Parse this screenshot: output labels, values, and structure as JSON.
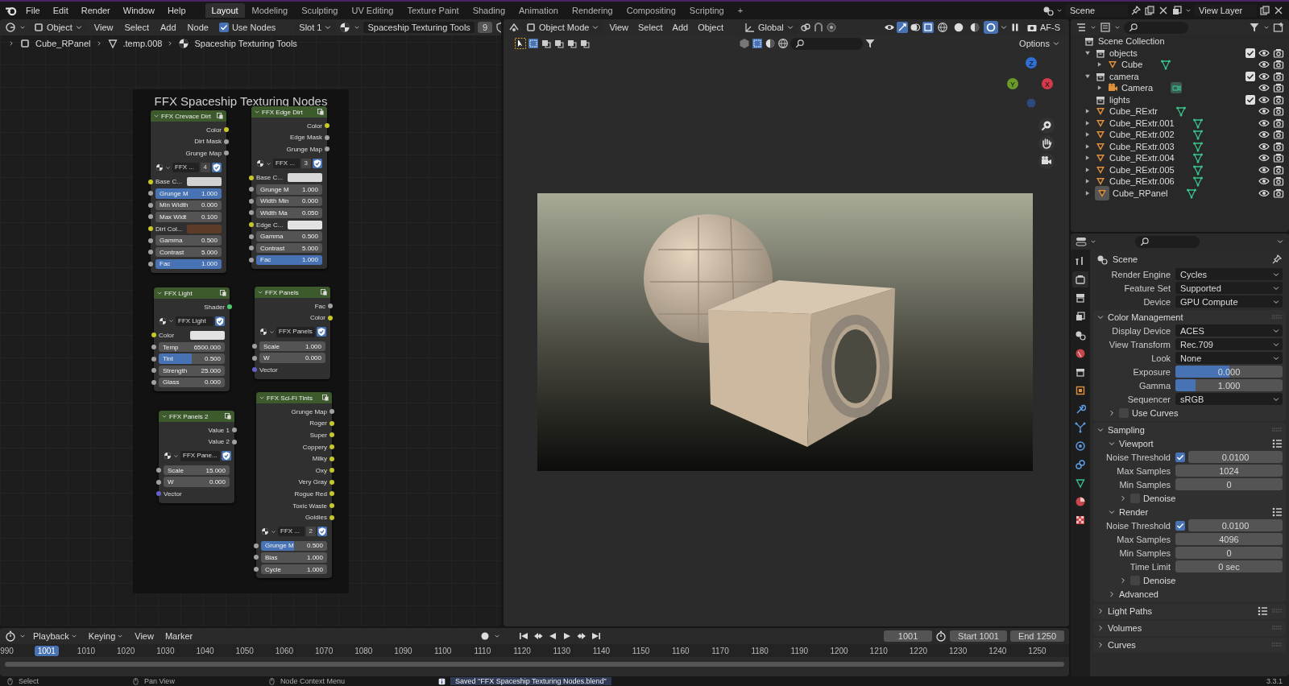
{
  "menu_bar": {
    "menus": [
      "File",
      "Edit",
      "Render",
      "Window",
      "Help"
    ],
    "workspaces": [
      {
        "label": "Layout",
        "selected": true
      },
      {
        "label": "Modeling",
        "selected": false
      },
      {
        "label": "Sculpting",
        "selected": false
      },
      {
        "label": "UV Editing",
        "selected": false
      },
      {
        "label": "Texture Paint",
        "selected": false
      },
      {
        "label": "Shading",
        "selected": false
      },
      {
        "label": "Animation",
        "selected": false
      },
      {
        "label": "Rendering",
        "selected": false
      },
      {
        "label": "Compositing",
        "selected": false
      },
      {
        "label": "Scripting",
        "selected": false
      }
    ],
    "add_workspace": "+",
    "scene": "Scene",
    "view_layer": "View Layer"
  },
  "node_editor": {
    "header": {
      "object": "Object",
      "menus": [
        "View",
        "Select",
        "Add",
        "Node"
      ],
      "use_nodes": {
        "label": "Use Nodes",
        "checked": true
      },
      "slot": "Slot 1",
      "material": "Spaceship Texturing Tools",
      "users": "9"
    },
    "breadcrumbs": [
      "Cube_RPanel",
      ".temp.008",
      "Spaceship Texturing Tools"
    ],
    "frame_title": "FFX Spaceship Texturing Nodes",
    "nodes": [
      {
        "title": "FFX Crevace Dirt",
        "rows": [
          {
            "kind": "output",
            "label": "Color",
            "socket": {
              "color": "#c7c729"
            }
          },
          {
            "kind": "output",
            "label": "Dirt Mask",
            "socket": {
              "color": "#a1a1a1"
            }
          },
          {
            "kind": "output",
            "label": "Grunge Map",
            "socket": {
              "color": "#a1a1a1"
            }
          },
          {
            "kind": "selector",
            "name": "FFX ...",
            "users": "4"
          },
          {
            "kind": "color",
            "label": "Base C...",
            "socket": {
              "color": "#c7c729"
            },
            "color": "#d2d2d2"
          },
          {
            "kind": "slider",
            "label": "Grunge M",
            "value": "1.000",
            "level": 1,
            "socket": {
              "color": "#a1a1a1"
            }
          },
          {
            "kind": "number",
            "label": "Min Width",
            "value": "0.000",
            "socket": {
              "color": "#a1a1a1"
            }
          },
          {
            "kind": "number",
            "label": "Max Widt",
            "value": "0.100",
            "socket": {
              "color": "#a1a1a1"
            }
          },
          {
            "kind": "color",
            "label": "Dirt Col...",
            "socket": {
              "color": "#c7c729"
            },
            "color": "#5c3c28"
          },
          {
            "kind": "number",
            "label": "Gamma",
            "value": "0.500",
            "socket": {
              "color": "#a1a1a1"
            }
          },
          {
            "kind": "number",
            "label": "Contrast",
            "value": "5.000",
            "socket": {
              "color": "#a1a1a1"
            }
          },
          {
            "kind": "slider",
            "label": "Fac",
            "value": "1.000",
            "level": 1,
            "socket": {
              "color": "#a1a1a1"
            }
          }
        ]
      },
      {
        "title": "FFX Edge Dirt",
        "rows": [
          {
            "kind": "output",
            "label": "Color",
            "socket": {
              "color": "#c7c729"
            }
          },
          {
            "kind": "output",
            "label": "Edge Mask",
            "socket": {
              "color": "#a1a1a1"
            }
          },
          {
            "kind": "output",
            "label": "Grunge Map",
            "socket": {
              "color": "#a1a1a1"
            }
          },
          {
            "kind": "selector",
            "name": "FFX ...",
            "users": "3"
          },
          {
            "kind": "color",
            "label": "Base C...",
            "socket": {
              "color": "#c7c729"
            },
            "color": "#d8d8d8"
          },
          {
            "kind": "number",
            "label": "Grunge M",
            "value": "1.000",
            "socket": {
              "color": "#a1a1a1"
            }
          },
          {
            "kind": "number",
            "label": "Width Min",
            "value": "0.000",
            "socket": {
              "color": "#a1a1a1"
            }
          },
          {
            "kind": "number",
            "label": "Width Ma",
            "value": "0.050",
            "socket": {
              "color": "#a1a1a1"
            }
          },
          {
            "kind": "color",
            "label": "Edge C...",
            "socket": {
              "color": "#c7c729"
            },
            "color": "#e2e2e2"
          },
          {
            "kind": "number",
            "label": "Gamma",
            "value": "0.500",
            "socket": {
              "color": "#a1a1a1"
            }
          },
          {
            "kind": "number",
            "label": "Contrast",
            "value": "5.000",
            "socket": {
              "color": "#a1a1a1"
            }
          },
          {
            "kind": "slider",
            "label": "Fac",
            "value": "1.000",
            "level": 1,
            "socket": {
              "color": "#a1a1a1"
            }
          }
        ]
      },
      {
        "title": "FFX Light",
        "rows": [
          {
            "kind": "output",
            "label": "Shader",
            "socket": {
              "color": "#4fc76a"
            }
          },
          {
            "kind": "selector",
            "name": "FFX Light"
          },
          {
            "kind": "color",
            "label": "Color",
            "socket": {
              "color": "#c7c729"
            },
            "color": "#e2e2e2"
          },
          {
            "kind": "number",
            "label": "Temp",
            "value": "6500.000",
            "socket": {
              "color": "#a1a1a1"
            }
          },
          {
            "kind": "slider",
            "label": "Tint",
            "value": "0.500",
            "level": 0.5,
            "socket": {
              "color": "#a1a1a1"
            }
          },
          {
            "kind": "number",
            "label": "Strength",
            "value": "25.000",
            "socket": {
              "color": "#a1a1a1"
            }
          },
          {
            "kind": "number",
            "label": "Glass",
            "value": "0.000",
            "socket": {
              "color": "#a1a1a1"
            }
          }
        ]
      },
      {
        "title": "FFX Panels",
        "rows": [
          {
            "kind": "output",
            "label": "Fac",
            "socket": {
              "color": "#a1a1a1"
            }
          },
          {
            "kind": "output",
            "label": "Color",
            "socket": {
              "color": "#c7c729"
            }
          },
          {
            "kind": "selector",
            "name": "FFX Panels"
          },
          {
            "kind": "number",
            "label": "Scale",
            "value": "1.000",
            "socket": {
              "color": "#a1a1a1"
            }
          },
          {
            "kind": "number",
            "label": "W",
            "value": "0.000",
            "socket": {
              "color": "#a1a1a1"
            }
          },
          {
            "kind": "input",
            "label": "Vector",
            "socket": {
              "color": "#6363c7"
            }
          }
        ]
      },
      {
        "title": "FFX Panels 2",
        "rows": [
          {
            "kind": "output",
            "label": "Value 1",
            "socket": {
              "color": "#a1a1a1"
            }
          },
          {
            "kind": "output",
            "label": "Value 2",
            "socket": {
              "color": "#a1a1a1"
            }
          },
          {
            "kind": "selector",
            "name": "FFX Pane..."
          },
          {
            "kind": "number",
            "label": "Scale",
            "value": "15.000",
            "socket": {
              "color": "#a1a1a1"
            }
          },
          {
            "kind": "number",
            "label": "W",
            "value": "0.000",
            "socket": {
              "color": "#a1a1a1"
            }
          },
          {
            "kind": "input",
            "label": "Vector",
            "socket": {
              "color": "#6363c7"
            }
          }
        ]
      },
      {
        "title": "FFX Sci-Fi Tints",
        "rows": [
          {
            "kind": "output",
            "label": "Grunge Map",
            "socket": {
              "color": "#a1a1a1"
            }
          },
          {
            "kind": "output",
            "label": "Roger",
            "socket": {
              "color": "#c7c729"
            }
          },
          {
            "kind": "output",
            "label": "Super",
            "socket": {
              "color": "#c7c729"
            }
          },
          {
            "kind": "output",
            "label": "Coppery",
            "socket": {
              "color": "#c7c729"
            }
          },
          {
            "kind": "output",
            "label": "Milky",
            "socket": {
              "color": "#c7c729"
            }
          },
          {
            "kind": "output",
            "label": "Oxy",
            "socket": {
              "color": "#c7c729"
            }
          },
          {
            "kind": "output",
            "label": "Very Gray",
            "socket": {
              "color": "#c7c729"
            }
          },
          {
            "kind": "output",
            "label": "Rogue Red",
            "socket": {
              "color": "#c7c729"
            }
          },
          {
            "kind": "output",
            "label": "Toxic Waste",
            "socket": {
              "color": "#c7c729"
            }
          },
          {
            "kind": "output",
            "label": "Goldies",
            "socket": {
              "color": "#c7c729"
            }
          },
          {
            "kind": "selector",
            "name": "FFX ...",
            "users": "2"
          },
          {
            "kind": "slider",
            "label": "Grunge M",
            "value": "0.500",
            "level": 0.5,
            "socket": {
              "color": "#a1a1a1"
            }
          },
          {
            "kind": "number",
            "label": "Bias",
            "value": "1.000",
            "socket": {
              "color": "#a1a1a1"
            }
          },
          {
            "kind": "number",
            "label": "Cycle",
            "value": "1.000",
            "socket": {
              "color": "#a1a1a1"
            }
          }
        ]
      }
    ]
  },
  "viewport": {
    "header": {
      "mode": "Object Mode",
      "menus": [
        "View",
        "Select",
        "Add",
        "Object"
      ],
      "orientation": "Global",
      "autofocus": "AF-S",
      "options": "Options"
    },
    "shading": [
      {
        "kind": "wireframe",
        "selected": false
      },
      {
        "kind": "solid",
        "selected": false
      },
      {
        "kind": "material",
        "selected": false
      },
      {
        "kind": "rendered",
        "selected": true
      }
    ],
    "gizmo_axes": [
      {
        "label": "Z",
        "color": "#2f6fd6"
      },
      {
        "label": "Y",
        "color": "#6a9a2a"
      },
      {
        "label": "X",
        "color": "#d63a4a"
      }
    ]
  },
  "outliner": {
    "root": "Scene Collection",
    "items": [
      {
        "name": "objects",
        "kind": "collection",
        "expanded": true,
        "checked": true,
        "children": [
          {
            "name": "Cube",
            "kind": "mesh",
            "expanded": false,
            "active": false
          }
        ]
      },
      {
        "name": "camera",
        "kind": "collection",
        "expanded": true,
        "checked": true,
        "children": [
          {
            "name": "Camera",
            "kind": "camera",
            "expanded": false,
            "active": false
          }
        ]
      },
      {
        "name": "lights",
        "kind": "collection",
        "checked": true
      },
      {
        "name": "Cube_RExtr",
        "kind": "mesh",
        "expanded": false,
        "active": false
      },
      {
        "name": "Cube_RExtr.001",
        "kind": "mesh",
        "expanded": false,
        "active": false
      },
      {
        "name": "Cube_RExtr.002",
        "kind": "mesh",
        "expanded": false,
        "active": false
      },
      {
        "name": "Cube_RExtr.003",
        "kind": "mesh",
        "expanded": false,
        "active": false
      },
      {
        "name": "Cube_RExtr.004",
        "kind": "mesh",
        "expanded": false,
        "active": false
      },
      {
        "name": "Cube_RExtr.005",
        "kind": "mesh",
        "expanded": false,
        "active": false
      },
      {
        "name": "Cube_RExtr.006",
        "kind": "mesh",
        "expanded": false,
        "active": false
      },
      {
        "name": "Cube_RPanel",
        "kind": "mesh",
        "expanded": false,
        "active": true
      }
    ]
  },
  "properties": {
    "tabs": [
      {
        "kind": "tool",
        "selected": false
      },
      {
        "kind": "render",
        "selected": true
      },
      {
        "kind": "output",
        "selected": false
      },
      {
        "kind": "view_layer",
        "selected": false
      },
      {
        "kind": "scene",
        "selected": false
      },
      {
        "kind": "world",
        "selected": false
      },
      {
        "kind": "collection",
        "selected": false
      },
      {
        "kind": "object",
        "selected": false
      },
      {
        "kind": "modifiers",
        "selected": false
      },
      {
        "kind": "particles",
        "selected": false
      },
      {
        "kind": "physics",
        "selected": false
      },
      {
        "kind": "constraints",
        "selected": false
      },
      {
        "kind": "data",
        "selected": false
      },
      {
        "kind": "material",
        "selected": false
      },
      {
        "kind": "texture",
        "selected": false
      }
    ],
    "context": "Scene",
    "rows": [
      {
        "kind": "dropdown",
        "label": "Render Engine",
        "value": "Cycles"
      },
      {
        "kind": "dropdown",
        "label": "Feature Set",
        "value": "Supported"
      },
      {
        "kind": "dropdown",
        "label": "Device",
        "value": "GPU Compute"
      }
    ],
    "panels": [
      {
        "title": "Color Management",
        "expanded": true,
        "presets": false,
        "rows": [
          {
            "kind": "dropdown",
            "label": "Display Device",
            "value": "ACES"
          },
          {
            "kind": "dropdown",
            "label": "View Transform",
            "value": "Rec.709"
          },
          {
            "kind": "dropdown",
            "label": "Look",
            "value": "None"
          },
          {
            "kind": "slider",
            "label": "Exposure",
            "value": "0.000",
            "level": 0.5
          },
          {
            "kind": "slider",
            "label": "Gamma",
            "value": "1.000",
            "level": 0.19
          },
          {
            "kind": "dropdown",
            "label": "Sequencer",
            "value": "sRGB"
          }
        ],
        "children": [
          {
            "title": "Use Curves",
            "expanded": false,
            "presets": false,
            "checked": false
          }
        ]
      },
      {
        "title": "Sampling",
        "expanded": true,
        "presets": false,
        "children": [
          {
            "title": "Viewport",
            "expanded": true,
            "presets": true,
            "rows": [
              {
                "kind": "check_number",
                "label": "Noise Threshold",
                "checked": true,
                "value": "0.0100"
              },
              {
                "kind": "number",
                "label": "Max Samples",
                "value": "1024"
              },
              {
                "kind": "number",
                "label": "Min Samples",
                "value": "0"
              }
            ],
            "children": [
              {
                "title": "Denoise",
                "expanded": false,
                "presets": false,
                "checked": false
              }
            ]
          },
          {
            "title": "Render",
            "expanded": true,
            "presets": true,
            "rows": [
              {
                "kind": "check_number",
                "label": "Noise Threshold",
                "checked": true,
                "value": "0.0100"
              },
              {
                "kind": "number",
                "label": "Max Samples",
                "value": "4096"
              },
              {
                "kind": "number",
                "label": "Min Samples",
                "value": "0"
              },
              {
                "kind": "number",
                "label": "Time Limit",
                "value": "0 sec"
              }
            ],
            "children": [
              {
                "title": "Denoise",
                "expanded": false,
                "presets": false,
                "checked": false
              }
            ]
          },
          {
            "title": "Advanced",
            "expanded": false,
            "presets": false
          }
        ]
      },
      {
        "title": "Light Paths",
        "expanded": false,
        "presets": true
      },
      {
        "title": "Volumes",
        "expanded": false,
        "presets": false
      },
      {
        "title": "Curves",
        "expanded": false,
        "presets": false
      }
    ]
  },
  "timeline": {
    "menus": [
      "Playback",
      "Keying",
      "View",
      "Marker"
    ],
    "current_frame": "1001",
    "start_label": "Start",
    "start": "1001",
    "end_label": "End",
    "end": "1250",
    "ruler": [
      {
        "label": "990",
        "selected": false
      },
      {
        "label": "1001",
        "selected": true
      },
      {
        "label": "1010",
        "selected": false
      },
      {
        "label": "1020",
        "selected": false
      },
      {
        "label": "1030",
        "selected": false
      },
      {
        "label": "1040",
        "selected": false
      },
      {
        "label": "1050",
        "selected": false
      },
      {
        "label": "1060",
        "selected": false
      },
      {
        "label": "1070",
        "selected": false
      },
      {
        "label": "1080",
        "selected": false
      },
      {
        "label": "1090",
        "selected": false
      },
      {
        "label": "1100",
        "selected": false
      },
      {
        "label": "1110",
        "selected": false
      },
      {
        "label": "1120",
        "selected": false
      },
      {
        "label": "1130",
        "selected": false
      },
      {
        "label": "1140",
        "selected": false
      },
      {
        "label": "1150",
        "selected": false
      },
      {
        "label": "1160",
        "selected": false
      },
      {
        "label": "1170",
        "selected": false
      },
      {
        "label": "1180",
        "selected": false
      },
      {
        "label": "1190",
        "selected": false
      },
      {
        "label": "1200",
        "selected": false
      },
      {
        "label": "1210",
        "selected": false
      },
      {
        "label": "1220",
        "selected": false
      },
      {
        "label": "1230",
        "selected": false
      },
      {
        "label": "1240",
        "selected": false
      },
      {
        "label": "1250",
        "selected": false
      }
    ]
  },
  "status_bar": {
    "hints": [
      "Select",
      "Pan View",
      "Node Context Menu"
    ],
    "message": "Saved \"FFX Spaceship Texturing Nodes.blend\"",
    "version": "3.3.1"
  }
}
